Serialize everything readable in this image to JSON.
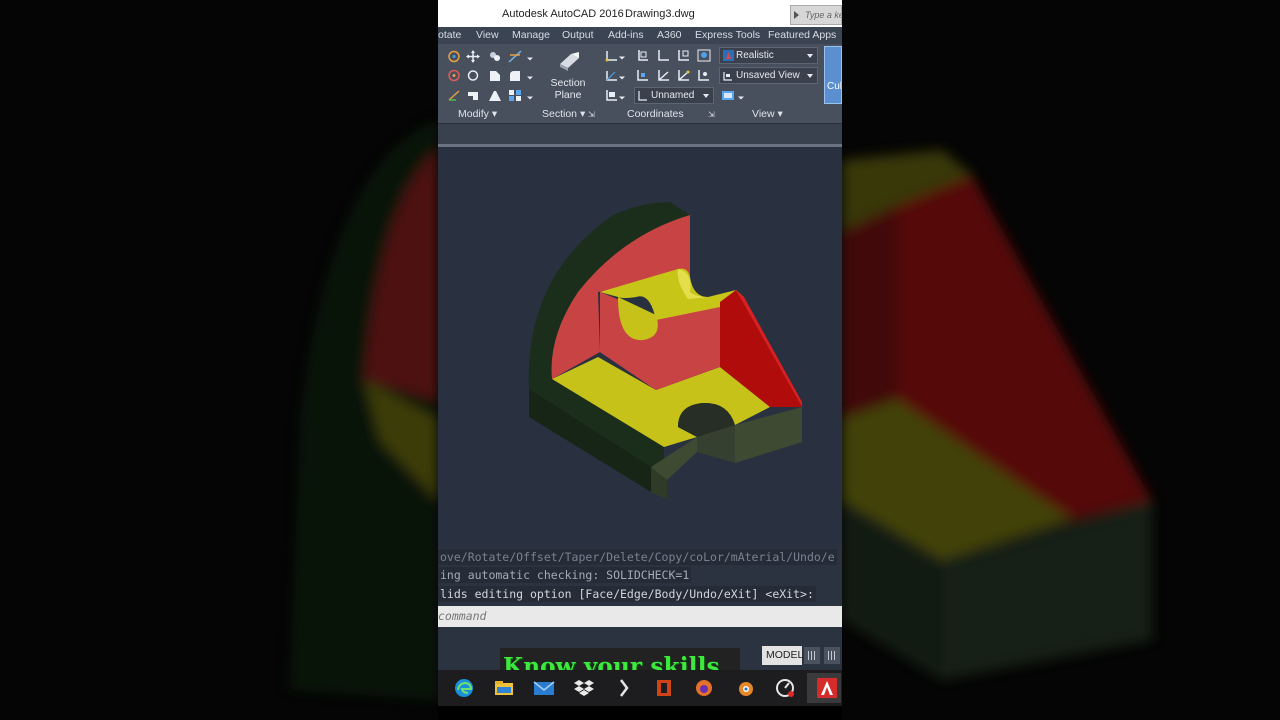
{
  "window": {
    "app_title": "Autodesk AutoCAD 2016",
    "document": "Drawing3.dwg",
    "search_placeholder": "Type a ke"
  },
  "tabs": [
    "otate",
    "View",
    "Manage",
    "Output",
    "Add-ins",
    "A360",
    "Express Tools",
    "Featured Apps"
  ],
  "ribbon": {
    "panels": {
      "modify": "Modify",
      "section": "Section",
      "coordinates": "Coordinates",
      "view": "View"
    },
    "section_plane_line1": "Section",
    "section_plane_line2": "Plane",
    "visual_style": "Realistic",
    "named_view": "Unsaved View",
    "ucs_name": "Unnamed",
    "cull_label": "Cull"
  },
  "command_history": {
    "line1": "ove/Rotate/Offset/Taper/Delete/Copy/coLor/mAterial/Undo/e",
    "line2": "ing automatic checking:  SOLIDCHECK=1",
    "line3": "lids editing option [Face/Edge/Body/Undo/eXit] <eXit>:"
  },
  "command_placeholder": "command",
  "status": {
    "model": "MODEL"
  },
  "overlay_caption": "Know your skills",
  "taskbar_icons": [
    "edge-icon",
    "file-explorer-icon",
    "mail-icon",
    "dropbox-icon",
    "terminal-icon",
    "office-icon",
    "firefox-icon",
    "blender-icon",
    "clock-icon",
    "autocad-icon"
  ],
  "colors": {
    "face_red": "#c74545",
    "face_yellow": "#c8c419",
    "face_darkgreen": "#1f3a1f",
    "face_olive": "#404a34",
    "viewport_bg": "#293140",
    "caption_green": "#3ee83e"
  }
}
